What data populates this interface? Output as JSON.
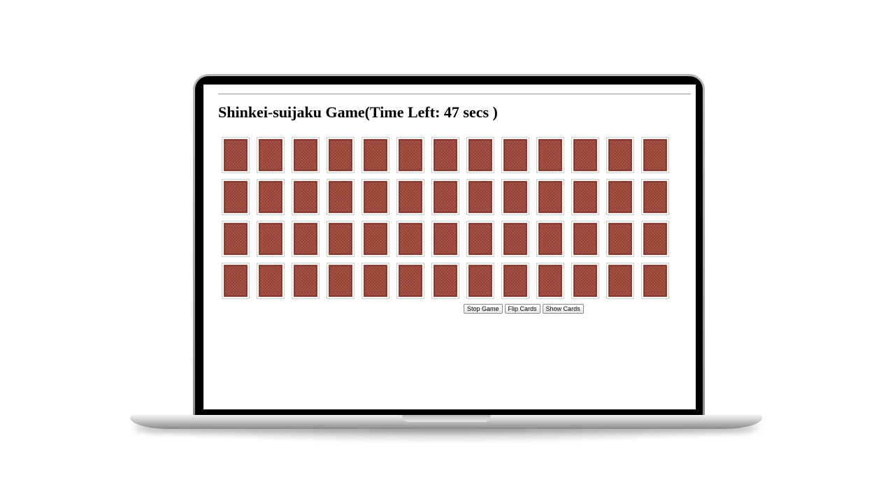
{
  "page": {
    "title": "Shinkei-suijaku Game(Time Left: 47 secs )"
  },
  "cards": {
    "rows": 4,
    "columns": 13,
    "back_color": "#a34a3c"
  },
  "buttons": {
    "stop_label": "Stop Game",
    "flip_label": "Flip Cards",
    "show_label": "Show Cards"
  }
}
